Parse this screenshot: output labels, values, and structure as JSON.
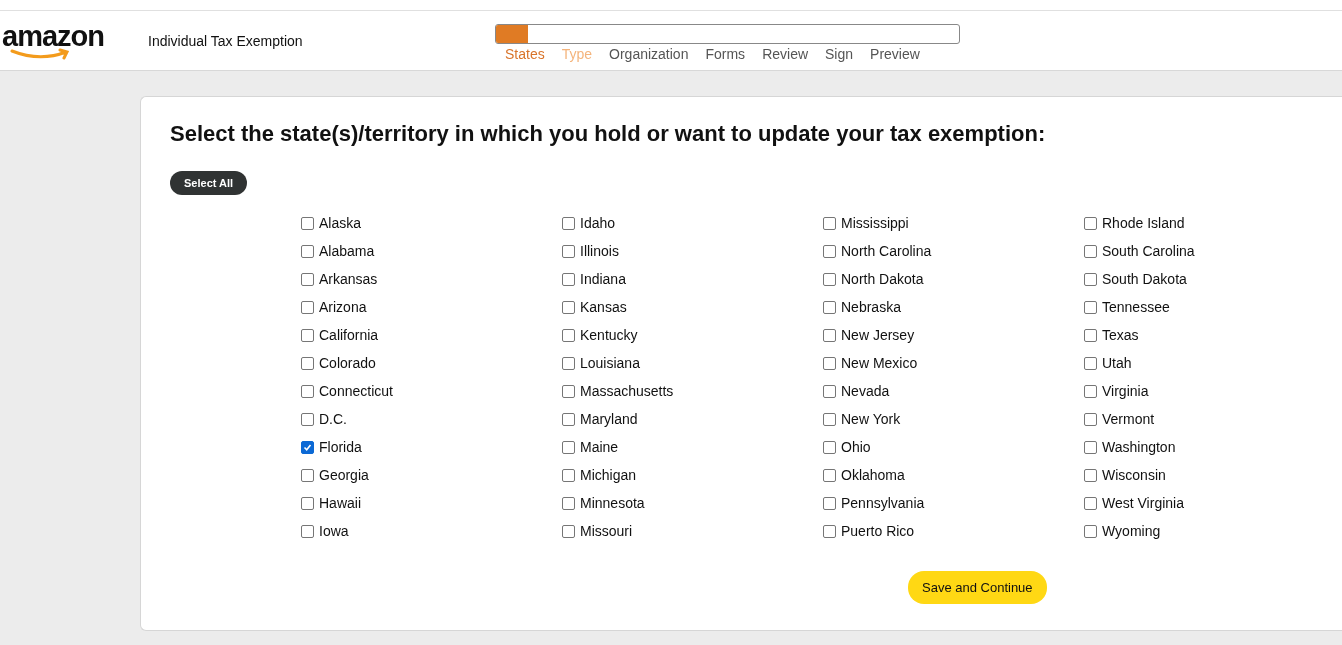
{
  "header": {
    "logo": "amazon",
    "title": "Individual Tax Exemption",
    "progress": {
      "level": 0.07
    },
    "steps": [
      {
        "label": "States",
        "selected": true,
        "available": true
      },
      {
        "label": "Type",
        "selected": false,
        "available": true
      },
      {
        "label": "Organization",
        "selected": false,
        "available": false
      },
      {
        "label": "Forms",
        "selected": false,
        "available": false
      },
      {
        "label": "Review",
        "selected": false,
        "available": false
      },
      {
        "label": "Sign",
        "selected": false,
        "available": false
      },
      {
        "label": "Preview",
        "selected": false,
        "available": false
      }
    ]
  },
  "heading": "Select the state(s)/territory in which you hold or want to update your tax exemption:",
  "select_all": "Select All",
  "columns": [
    [
      {
        "label": "Alaska",
        "checked": false
      },
      {
        "label": "Alabama",
        "checked": false
      },
      {
        "label": "Arkansas",
        "checked": false
      },
      {
        "label": "Arizona",
        "checked": false
      },
      {
        "label": "California",
        "checked": false
      },
      {
        "label": "Colorado",
        "checked": false
      },
      {
        "label": "Connecticut",
        "checked": false
      },
      {
        "label": "D.C.",
        "checked": false
      },
      {
        "label": "Florida",
        "checked": true
      },
      {
        "label": "Georgia",
        "checked": false
      },
      {
        "label": "Hawaii",
        "checked": false
      },
      {
        "label": "Iowa",
        "checked": false
      }
    ],
    [
      {
        "label": "Idaho",
        "checked": false
      },
      {
        "label": "Illinois",
        "checked": false
      },
      {
        "label": "Indiana",
        "checked": false
      },
      {
        "label": "Kansas",
        "checked": false
      },
      {
        "label": "Kentucky",
        "checked": false
      },
      {
        "label": "Louisiana",
        "checked": false
      },
      {
        "label": "Massachusetts",
        "checked": false
      },
      {
        "label": "Maryland",
        "checked": false
      },
      {
        "label": "Maine",
        "checked": false
      },
      {
        "label": "Michigan",
        "checked": false
      },
      {
        "label": "Minnesota",
        "checked": false
      },
      {
        "label": "Missouri",
        "checked": false
      }
    ],
    [
      {
        "label": "Mississippi",
        "checked": false
      },
      {
        "label": "North Carolina",
        "checked": false
      },
      {
        "label": "North Dakota",
        "checked": false
      },
      {
        "label": "Nebraska",
        "checked": false
      },
      {
        "label": "New Jersey",
        "checked": false
      },
      {
        "label": "New Mexico",
        "checked": false
      },
      {
        "label": "Nevada",
        "checked": false
      },
      {
        "label": "New York",
        "checked": false
      },
      {
        "label": "Ohio",
        "checked": false
      },
      {
        "label": "Oklahoma",
        "checked": false
      },
      {
        "label": "Pennsylvania",
        "checked": false
      },
      {
        "label": "Puerto Rico",
        "checked": false
      }
    ],
    [
      {
        "label": "Rhode Island",
        "checked": false
      },
      {
        "label": "South Carolina",
        "checked": false
      },
      {
        "label": "South Dakota",
        "checked": false
      },
      {
        "label": "Tennessee",
        "checked": false
      },
      {
        "label": "Texas",
        "checked": false
      },
      {
        "label": "Utah",
        "checked": false
      },
      {
        "label": "Virginia",
        "checked": false
      },
      {
        "label": "Vermont",
        "checked": false
      },
      {
        "label": "Washington",
        "checked": false
      },
      {
        "label": "Wisconsin",
        "checked": false
      },
      {
        "label": "West Virginia",
        "checked": false
      },
      {
        "label": "Wyoming",
        "checked": false
      }
    ]
  ],
  "save_button": "Save and Continue"
}
